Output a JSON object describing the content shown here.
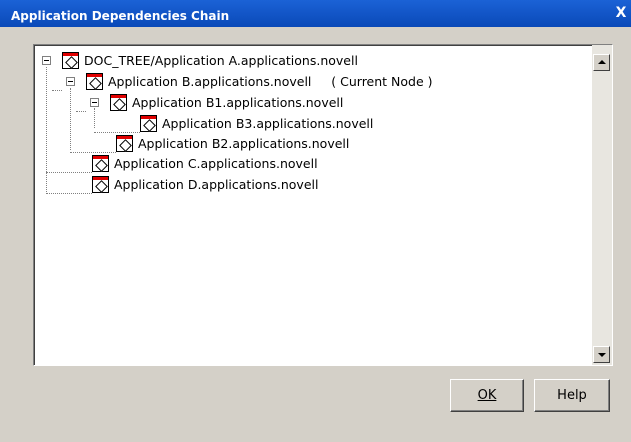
{
  "window": {
    "title": "Application Dependencies Chain",
    "close_label": "X"
  },
  "tree": {
    "nodes": [
      {
        "label": "DOC_TREE/Application A.applications.novell"
      },
      {
        "label": "Application B.applications.novell     ( Current Node )"
      },
      {
        "label": "Application B1.applications.novell"
      },
      {
        "label": "Application B3.applications.novell"
      },
      {
        "label": "Application B2.applications.novell"
      },
      {
        "label": "Application C.applications.novell"
      },
      {
        "label": "Application D.applications.novell"
      }
    ]
  },
  "buttons": {
    "ok_label": "OK",
    "help_label": "Help"
  },
  "colors": {
    "titlebar": "#0a49b8",
    "icon_accent": "#e00000",
    "dialog_bg": "#d4d0c8"
  }
}
